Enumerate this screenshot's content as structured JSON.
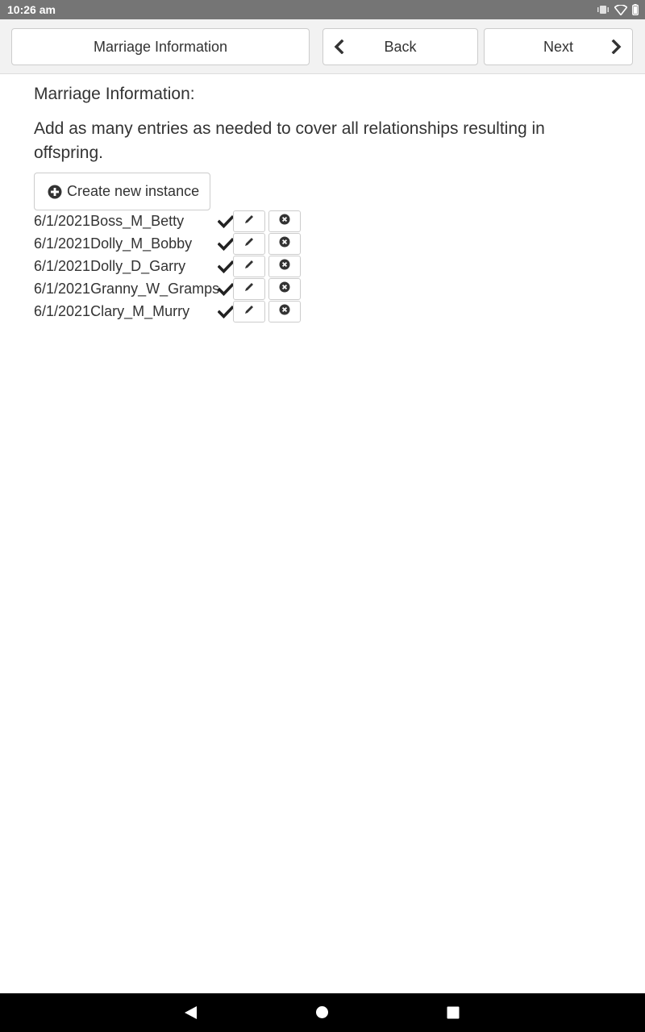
{
  "status_bar": {
    "time": "10:26 am",
    "icons": [
      "vibrate-icon",
      "wifi-icon",
      "battery-icon"
    ]
  },
  "toolbar": {
    "title_label": "Marriage Information",
    "back_label": "Back",
    "next_label": "Next"
  },
  "prompt": {
    "title": "Marriage Information:",
    "hint": "Add as many entries as needed to cover all relationships resulting in offspring."
  },
  "create_button": {
    "label": "Create new instance",
    "icon": "plus-circle-icon"
  },
  "instances": [
    {
      "label": "6/1/2021Boss_M_Betty",
      "complete": true
    },
    {
      "label": "6/1/2021Dolly_M_Bobby",
      "complete": true
    },
    {
      "label": "6/1/2021Dolly_D_Garry",
      "complete": true
    },
    {
      "label": "6/1/2021Granny_W_Gramps",
      "complete": true
    },
    {
      "label": "6/1/2021Clary_M_Murry",
      "complete": true
    }
  ],
  "nav_bar": {
    "icons": [
      "back-triangle-icon",
      "home-circle-icon",
      "recents-square-icon"
    ]
  },
  "colors": {
    "status_bar": "#757575",
    "toolbar_bg": "#f2f2f2",
    "button_border": "#cccccc",
    "text": "#333333",
    "nav_bar": "#000000"
  }
}
